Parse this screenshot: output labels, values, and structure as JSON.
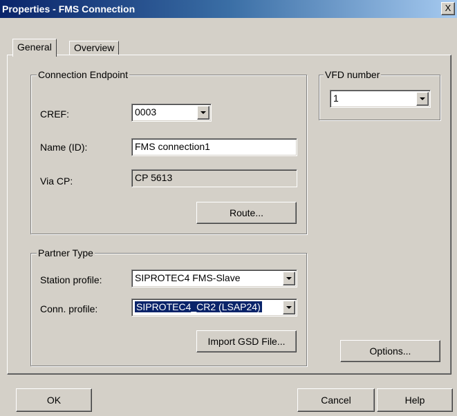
{
  "window": {
    "title": "Properties - FMS Connection",
    "close_label": "X"
  },
  "tabs": [
    {
      "label": "General"
    },
    {
      "label": "Overview"
    }
  ],
  "connection_endpoint": {
    "legend": "Connection Endpoint",
    "cref_label": "CREF:",
    "cref_value": "0003",
    "name_label": "Name (ID):",
    "name_value": "FMS connection1",
    "via_cp_label": "Via CP:",
    "via_cp_value": "CP 5613",
    "route_button": "Route..."
  },
  "vfd": {
    "legend": "VFD number",
    "value": "1"
  },
  "partner_type": {
    "legend": "Partner Type",
    "station_profile_label": "Station profile:",
    "station_profile_value": "SIPROTEC4 FMS-Slave",
    "conn_profile_label": "Conn. profile:",
    "conn_profile_value": "SIPROTEC4_CR2 (LSAP24)",
    "import_button": "Import GSD File..."
  },
  "options_button": "Options...",
  "footer": {
    "ok": "OK",
    "cancel": "Cancel",
    "help": "Help"
  }
}
